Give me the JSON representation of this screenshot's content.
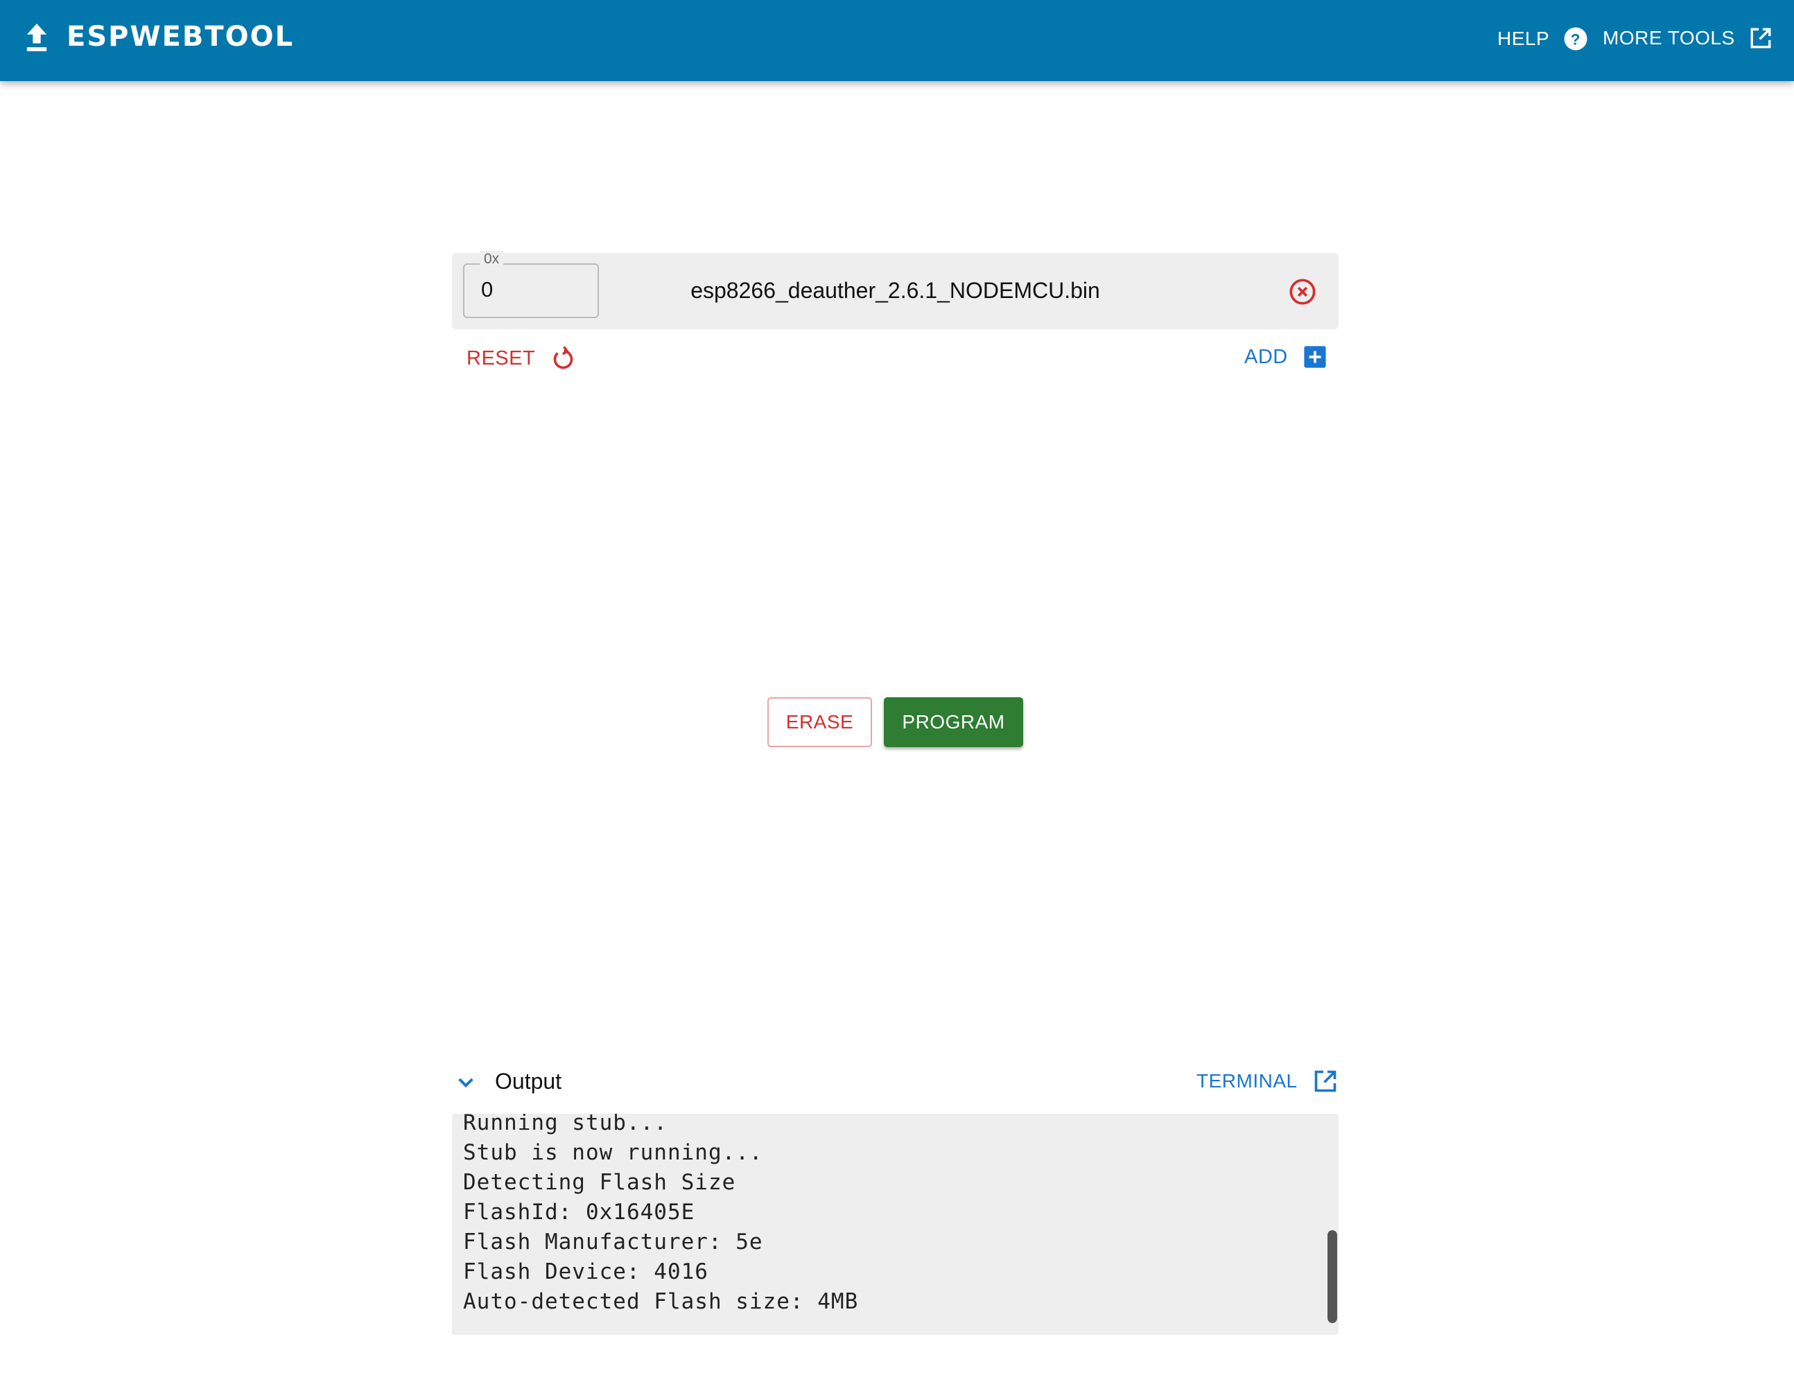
{
  "header": {
    "title": "ESPWEBTOOL",
    "help": "HELP",
    "more_tools": "MORE TOOLS"
  },
  "file": {
    "offset_label": "0x",
    "offset_value": "0",
    "filename": "esp8266_deauther_2.6.1_NODEMCU.bin"
  },
  "actions": {
    "reset": "RESET",
    "add": "ADD",
    "erase": "ERASE",
    "program": "PROGRAM"
  },
  "output": {
    "title": "Output",
    "terminal": "TERMINAL",
    "lines": [
      "Running stub...",
      "Stub is now running...",
      "Detecting Flash Size",
      "FlashId: 0x16405E",
      "Flash Manufacturer: 5e",
      "Flash Device: 4016",
      "Auto-detected Flash size: 4MB"
    ]
  },
  "colors": {
    "header": "#0377ac",
    "danger": "#d32f2f",
    "primary": "#1976d2",
    "success": "#2e7d32"
  }
}
